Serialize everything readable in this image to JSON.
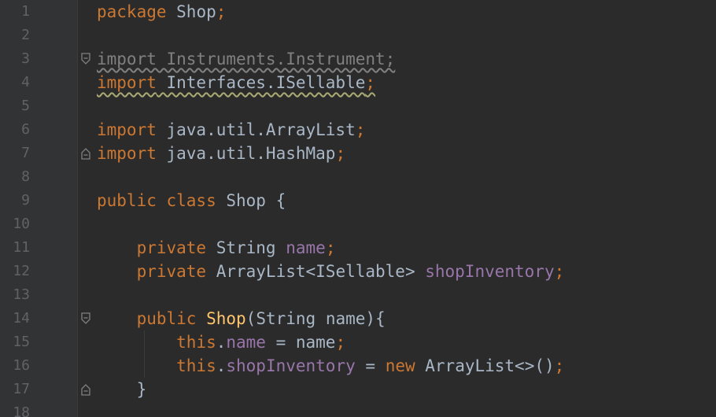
{
  "editor": {
    "lines": [
      {
        "n": "1",
        "tokens": [
          {
            "t": "package",
            "c": "kw"
          },
          {
            "t": " Shop",
            "c": "plain"
          },
          {
            "t": ";",
            "c": "punct"
          }
        ]
      },
      {
        "n": "2",
        "tokens": []
      },
      {
        "n": "3",
        "tokens": [
          {
            "t": "import Instruments.Instrument;",
            "c": "unused"
          }
        ]
      },
      {
        "n": "4",
        "tokens": [
          {
            "t": "import",
            "c": "kw warn"
          },
          {
            "t": " Interfaces.ISellable",
            "c": "plain warn"
          },
          {
            "t": ";",
            "c": "punct warn"
          }
        ]
      },
      {
        "n": "5",
        "tokens": []
      },
      {
        "n": "6",
        "tokens": [
          {
            "t": "import",
            "c": "kw"
          },
          {
            "t": " java.util.ArrayList",
            "c": "plain"
          },
          {
            "t": ";",
            "c": "punct"
          }
        ]
      },
      {
        "n": "7",
        "tokens": [
          {
            "t": "import",
            "c": "kw"
          },
          {
            "t": " java.util.HashMap",
            "c": "plain"
          },
          {
            "t": ";",
            "c": "punct"
          }
        ]
      },
      {
        "n": "8",
        "tokens": []
      },
      {
        "n": "9",
        "tokens": [
          {
            "t": "public class",
            "c": "kw"
          },
          {
            "t": " Shop {",
            "c": "plain"
          }
        ]
      },
      {
        "n": "10",
        "tokens": []
      },
      {
        "n": "11",
        "tokens": [
          {
            "t": "    private",
            "c": "kw"
          },
          {
            "t": " String ",
            "c": "plain"
          },
          {
            "t": "name",
            "c": "field"
          },
          {
            "t": ";",
            "c": "punct"
          }
        ]
      },
      {
        "n": "12",
        "tokens": [
          {
            "t": "    private",
            "c": "kw"
          },
          {
            "t": " ArrayList<ISellable> ",
            "c": "plain"
          },
          {
            "t": "shopInventory",
            "c": "field"
          },
          {
            "t": ";",
            "c": "punct"
          }
        ]
      },
      {
        "n": "13",
        "tokens": []
      },
      {
        "n": "14",
        "tokens": [
          {
            "t": "    public",
            "c": "kw"
          },
          {
            "t": " ",
            "c": "plain"
          },
          {
            "t": "Shop",
            "c": "method"
          },
          {
            "t": "(String name){",
            "c": "plain"
          }
        ]
      },
      {
        "n": "15",
        "tokens": [
          {
            "t": "        this",
            "c": "kw"
          },
          {
            "t": ".",
            "c": "plain"
          },
          {
            "t": "name",
            "c": "field"
          },
          {
            "t": " = name",
            "c": "plain"
          },
          {
            "t": ";",
            "c": "punct"
          }
        ]
      },
      {
        "n": "16",
        "tokens": [
          {
            "t": "        this",
            "c": "kw"
          },
          {
            "t": ".",
            "c": "plain"
          },
          {
            "t": "shopInventory",
            "c": "field"
          },
          {
            "t": " = ",
            "c": "plain"
          },
          {
            "t": "new",
            "c": "kw"
          },
          {
            "t": " ArrayList<>()",
            "c": "plain"
          },
          {
            "t": ";",
            "c": "punct"
          }
        ]
      },
      {
        "n": "17",
        "tokens": [
          {
            "t": "    }",
            "c": "plain"
          }
        ]
      },
      {
        "n": "18",
        "tokens": []
      }
    ],
    "fold_markers": [
      {
        "line": 3,
        "kind": "fold-start"
      },
      {
        "line": 7,
        "kind": "fold-end"
      },
      {
        "line": 14,
        "kind": "fold-start"
      },
      {
        "line": 17,
        "kind": "fold-end"
      }
    ]
  }
}
